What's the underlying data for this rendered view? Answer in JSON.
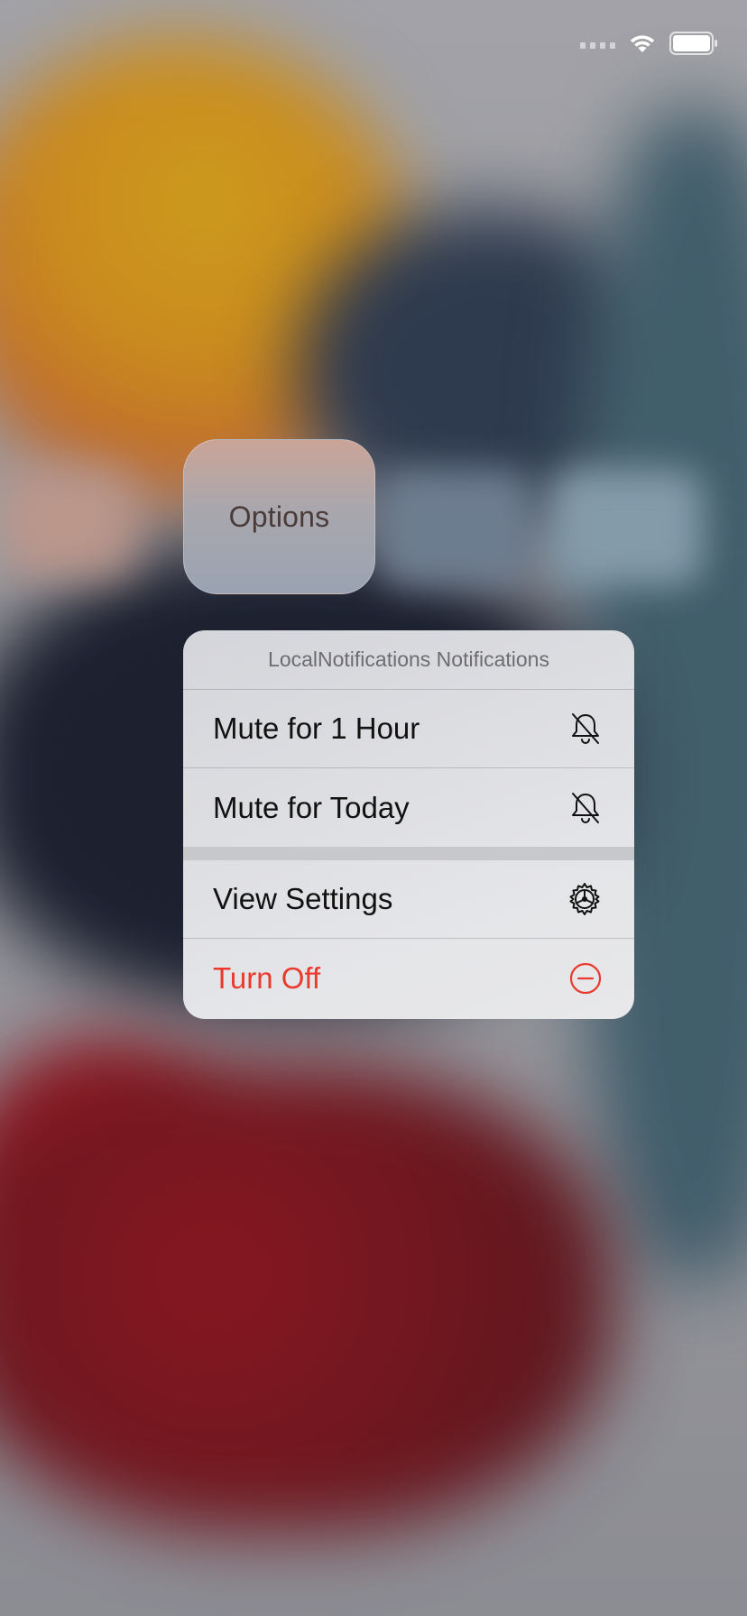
{
  "status_bar": {
    "signal_icon": "cellular-signal-icon",
    "wifi_icon": "wifi-icon",
    "battery_icon": "battery-icon"
  },
  "options_tile": {
    "label": "Options"
  },
  "menu": {
    "header": "LocalNotifications Notifications",
    "items": [
      {
        "label": "Mute for 1 Hour",
        "icon": "bell-slash-icon"
      },
      {
        "label": "Mute for Today",
        "icon": "bell-slash-icon"
      },
      {
        "label": "View Settings",
        "icon": "gear-icon"
      },
      {
        "label": "Turn Off",
        "icon": "minus-circle-icon",
        "color": "#ea3a2e"
      }
    ]
  }
}
